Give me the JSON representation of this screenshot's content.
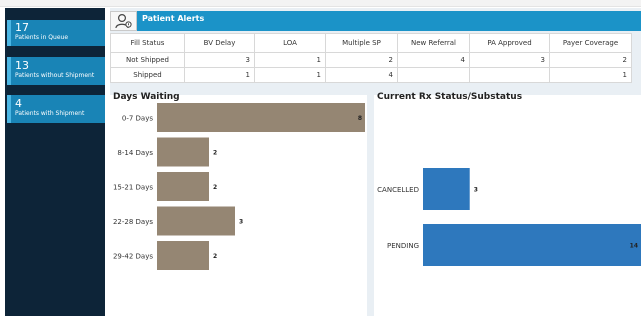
{
  "sidebar": {
    "stats": [
      {
        "value": "17",
        "label": "Patients in Queue"
      },
      {
        "value": "13",
        "label": "Patients without Shipment"
      },
      {
        "value": "4",
        "label": "Patients with Shipment"
      }
    ]
  },
  "alerts": {
    "title": "Patient Alerts",
    "columns": [
      "Fill Status",
      "BV Delay",
      "LOA",
      "Multiple SP",
      "New Referral",
      "PA Approved",
      "Payer Coverage"
    ],
    "rows": [
      {
        "label": "Not Shipped",
        "values": [
          "3",
          "1",
          "2",
          "4",
          "3",
          "2"
        ]
      },
      {
        "label": "Shipped",
        "values": [
          "1",
          "1",
          "4",
          "",
          "",
          "1"
        ]
      }
    ]
  },
  "chart_data": [
    {
      "type": "bar",
      "orientation": "horizontal",
      "title": "Days Waiting",
      "categories": [
        "0-7 Days",
        "8-14 Days",
        "15-21 Days",
        "22-28 Days",
        "29-42 Days"
      ],
      "values": [
        8,
        2,
        2,
        3,
        2
      ],
      "xlim": [
        0,
        8
      ],
      "bar_color": "#958673"
    },
    {
      "type": "bar",
      "orientation": "horizontal",
      "title": "Current Rx Status/Substatus",
      "categories": [
        "CANCELLED",
        "PENDING"
      ],
      "values": [
        3,
        14
      ],
      "xlim": [
        0,
        14
      ],
      "bar_color": "#2e78bd"
    }
  ]
}
